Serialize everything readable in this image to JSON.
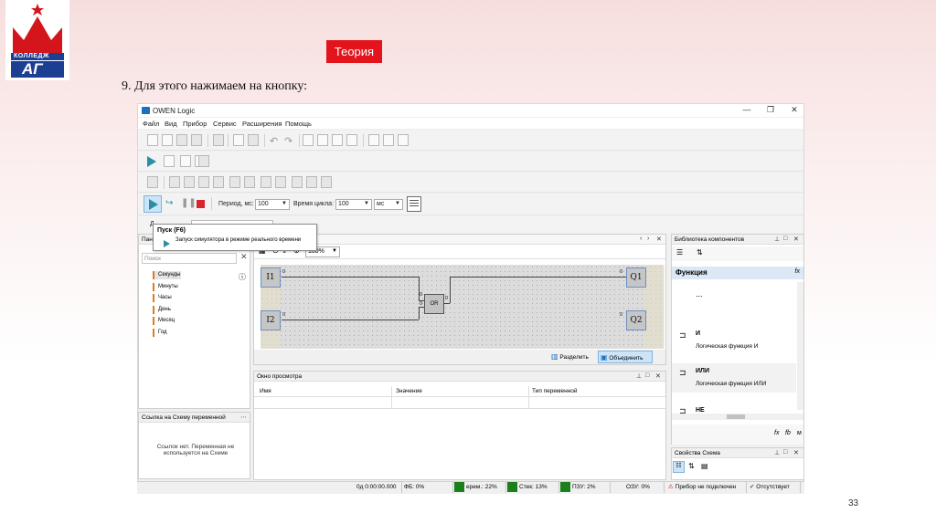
{
  "logo": {
    "text": "КОЛЛЕДЖ",
    "monogram": "АГ"
  },
  "slide": {
    "theory_label": "Теория",
    "instruction": "9. Для этого нажимаем на кнопку:",
    "page_number": "33"
  },
  "window": {
    "title": "OWEN Logic",
    "minimize": "—",
    "maximize": "❐",
    "close": "✕"
  },
  "menu": [
    "Файл",
    "Вид",
    "Прибор",
    "Сервис",
    "Расширения",
    "Помощь"
  ],
  "sim_toolbar": {
    "period_label": "Период, мс:",
    "period_value": "100",
    "cycle_label": "Время цикла:",
    "cycle_value": "100",
    "cycle_unit": "мс"
  },
  "tooltip": {
    "title": "Пуск (F6)",
    "description": "Запуск симулятора в режиме реального времени"
  },
  "left_panel": {
    "header": "Пане",
    "search_placeholder": "Поиск",
    "items": [
      "Секунды",
      "Минуты",
      "Часы",
      "День",
      "Месяц",
      "Год"
    ]
  },
  "ref_panel": {
    "header": "Ссылка на Схему переменной",
    "message": "Ссылок нет. Переменная не используется на Схеме"
  },
  "canvas": {
    "zoom": "100%",
    "inputs": [
      "I1",
      "I2"
    ],
    "outputs": [
      "Q1",
      "Q2"
    ],
    "gate": "OR",
    "pin": "0",
    "split_label": "Разделить",
    "merge_label": "Объединить"
  },
  "watch": {
    "header": "Окно просмотра",
    "columns": [
      "Имя",
      "Значение",
      "Тип переменной"
    ]
  },
  "library": {
    "header": "Библиотека компонентов",
    "category": "Функция",
    "fx": "fx",
    "ellipsis": "...",
    "items": [
      {
        "name": "И",
        "desc": "Логическая функция И"
      },
      {
        "name": "ИЛИ",
        "desc": "Логическая функция ИЛИ"
      },
      {
        "name": "НЕ",
        "desc": ""
      }
    ],
    "tabs": [
      "fx",
      "fb",
      "м"
    ]
  },
  "props": {
    "header": "Свойства Схема"
  },
  "status": {
    "time": "0д 0:00:00.000",
    "fb": "ФБ: 0%",
    "vars": "ерем.: 22%",
    "stack": "Стек: 13%",
    "rom": "ПЗУ: 2%",
    "ram": "ОЗУ: 0%",
    "device": "Прибор не подключен",
    "missing": "Отсутствует"
  }
}
